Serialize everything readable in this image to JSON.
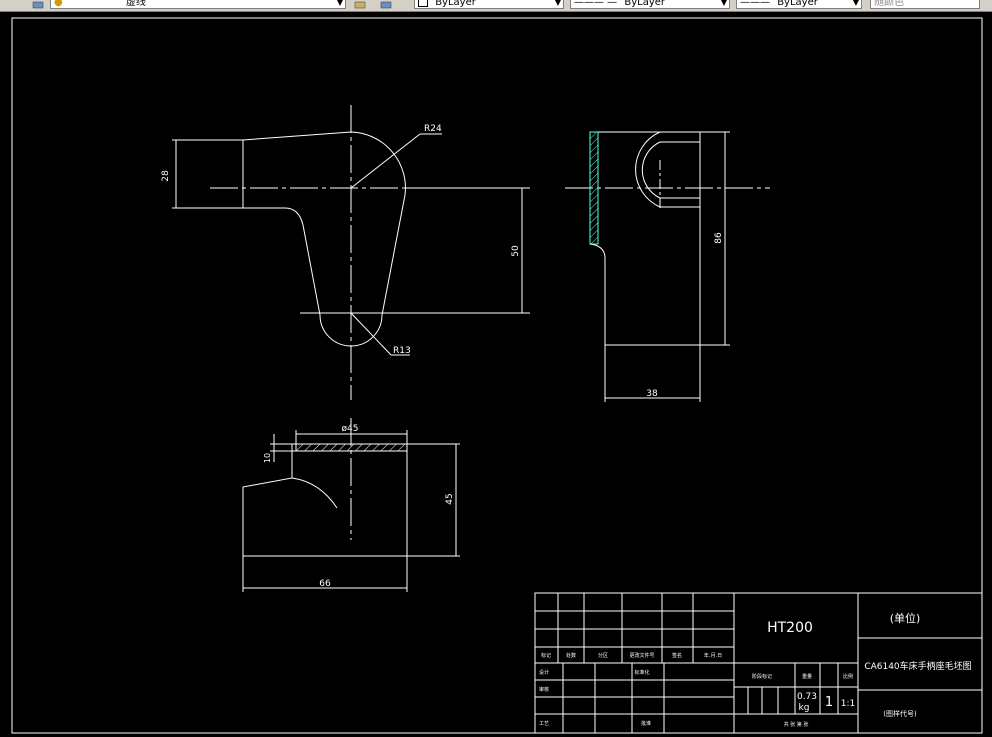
{
  "toolbar": {
    "layer_name": "虚线",
    "color_label": "ByLayer",
    "linetype_label": "ByLayer",
    "lineweight_label": "ByLayer",
    "plotstyle_label": "随颜色"
  },
  "drawing": {
    "dims": {
      "d28": "28",
      "r24": "R24",
      "d50": "50",
      "r13": "R13",
      "d86": "86",
      "d38": "38",
      "phi45": "ø45",
      "d10": "10",
      "d45": "45",
      "d66": "66"
    }
  },
  "title_block": {
    "material": "HT200",
    "unit": "(单位)",
    "drawing_name": "CA6140车床手柄座毛坯图",
    "drawing_code": "(图样代号)",
    "weight": "0.73\nkg",
    "weight_value": "0.73",
    "weight_unit": "kg",
    "qty": "1",
    "scale": "1:1",
    "header_mark": "标记",
    "header_count": "处数",
    "header_zone": "分区",
    "header_change": "更改文件号",
    "header_sign": "签名",
    "header_date": "年.月.日",
    "design": "设计",
    "standard": "标准化",
    "check": "审核",
    "process": "工艺",
    "approve": "批准",
    "stage_label": "阶段标记",
    "weight_label": "重量",
    "scale_label": "比例",
    "sheets_label": "共   张   第   张"
  }
}
